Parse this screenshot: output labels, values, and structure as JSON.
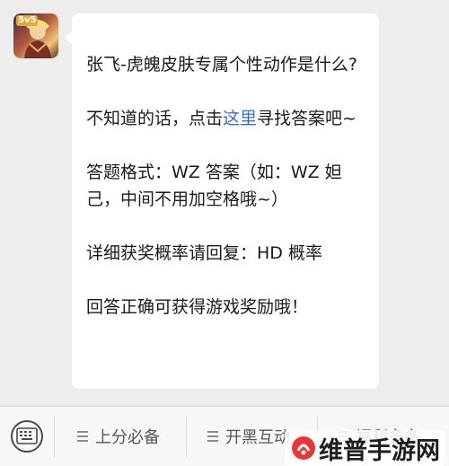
{
  "chat": {
    "avatar": {
      "icon": "game-avatar-icon",
      "badge_text": "5v5"
    },
    "message": {
      "line1": "张飞-虎魄皮肤专属个性动作是什么?",
      "line2_prefix": "不知道的话，点击",
      "line2_link": "这里",
      "line2_suffix": "寻找答案吧~",
      "line3": "答题格式：WZ 答案（如：WZ 妲己，中间不用加空格哦~）",
      "line4": "详细获奖概率请回复：HD 概率",
      "line5": "回答正确可获得游戏奖励哦！"
    }
  },
  "bottom_bar": {
    "keyboard_icon": "keyboard-icon",
    "menus": [
      {
        "label": "上分必备",
        "icon": "menu-list-icon"
      },
      {
        "label": "开黑互动",
        "icon": "menu-list-icon"
      },
      {
        "label": "福利多多",
        "icon": "menu-list-icon"
      }
    ]
  },
  "watermark": {
    "text": "维普手游网"
  },
  "colors": {
    "link": "#3f6fb5",
    "background": "#ededed",
    "bubble": "#ffffff"
  }
}
